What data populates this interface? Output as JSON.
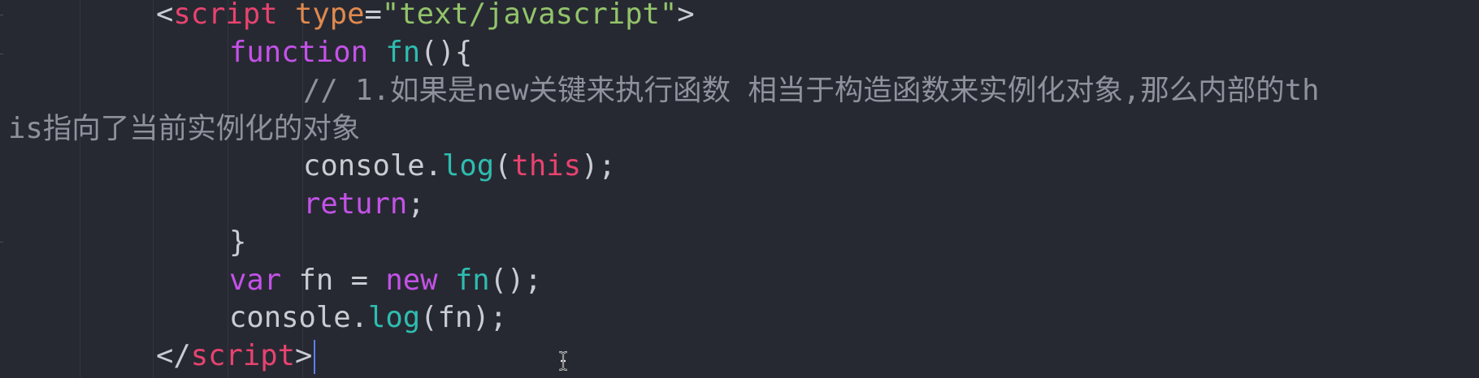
{
  "editor": {
    "lines": [
      {
        "tokens": [
          {
            "t": "<",
            "c": "punc"
          },
          {
            "t": "script",
            "c": "tag"
          },
          {
            "t": " ",
            "c": "punc"
          },
          {
            "t": "type",
            "c": "attr"
          },
          {
            "t": "=",
            "c": "punc"
          },
          {
            "t": "\"text/javascript\"",
            "c": "str"
          },
          {
            "t": ">",
            "c": "punc"
          }
        ]
      },
      {
        "tokens": [
          {
            "t": "function",
            "c": "kw"
          },
          {
            "t": " ",
            "c": "punc"
          },
          {
            "t": "fn",
            "c": "fnname"
          },
          {
            "t": "(){",
            "c": "punc"
          }
        ]
      },
      {
        "tokens": [
          {
            "t": "// 1.如果是new关键来执行函数 相当于构造函数来实例化对象,那么内部的th",
            "c": "comment"
          }
        ]
      },
      {
        "tokens": [
          {
            "t": "is指向了当前实例化的对象",
            "c": "comment"
          }
        ]
      },
      {
        "tokens": [
          {
            "t": "console.",
            "c": "punc"
          },
          {
            "t": "log",
            "c": "fnname"
          },
          {
            "t": "(",
            "c": "punc"
          },
          {
            "t": "this",
            "c": "this"
          },
          {
            "t": ");",
            "c": "punc"
          }
        ]
      },
      {
        "tokens": [
          {
            "t": "return",
            "c": "kw"
          },
          {
            "t": ";",
            "c": "punc"
          }
        ]
      },
      {
        "tokens": [
          {
            "t": "}",
            "c": "punc"
          }
        ]
      },
      {
        "tokens": [
          {
            "t": "var",
            "c": "kw"
          },
          {
            "t": " fn = ",
            "c": "punc"
          },
          {
            "t": "new",
            "c": "kw"
          },
          {
            "t": " ",
            "c": "punc"
          },
          {
            "t": "fn",
            "c": "fnname"
          },
          {
            "t": "();",
            "c": "punc"
          }
        ]
      },
      {
        "tokens": [
          {
            "t": "console.",
            "c": "punc"
          },
          {
            "t": "log",
            "c": "fnname"
          },
          {
            "t": "(fn);",
            "c": "punc"
          }
        ]
      },
      {
        "tokens": [
          {
            "t": "</",
            "c": "punc"
          },
          {
            "t": "script",
            "c": "tag"
          },
          {
            "t": ">",
            "c": "punc"
          }
        ]
      }
    ]
  },
  "colors": {
    "background": "#272932",
    "tag": "#e8436f",
    "keyword": "#c452e8",
    "function": "#2ebdb0",
    "string": "#92c46a",
    "attribute": "#e0894e",
    "comment": "#8e929c",
    "cursor": "#5d7ef0"
  },
  "cursor": {
    "line": 9,
    "after_text": "console.log(fn);"
  },
  "icons": {
    "mouse_pointer": "i-beam-cursor-icon"
  }
}
